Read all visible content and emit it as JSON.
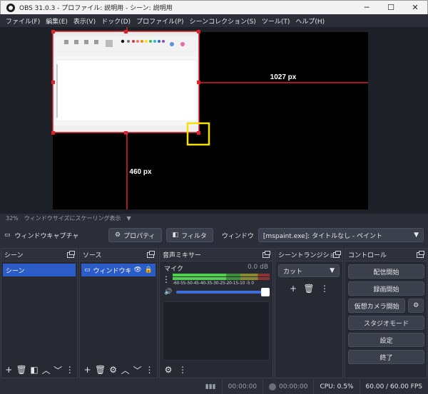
{
  "window": {
    "title": "OBS 31.0.3 - プロファイル: 説明用 - シーン: 説明用",
    "min": "─",
    "max": "☐",
    "close": "✕"
  },
  "menu": [
    "ファイル(F)",
    "編集(E)",
    "表示(V)",
    "ドック(D)",
    "プロファイル(P)",
    "シーンコレクション(S)",
    "ツール(T)",
    "ヘルプ(H)"
  ],
  "preview": {
    "width_label": "1027 px",
    "height_label": "460 px",
    "scale": "32%",
    "scale_mode": "ウィンドウサイズにスケーリング表示"
  },
  "context": {
    "source_name": "ウィンドウキャプチャ",
    "properties": "プロパティ",
    "filters": "フィルタ",
    "window_label": "ウィンドウ",
    "window_value": "[mspaint.exe]: タイトルなし - ペイント"
  },
  "scenes": {
    "title": "シーン",
    "items": [
      "シーン"
    ]
  },
  "sources": {
    "title": "ソース",
    "items": [
      {
        "name": "ウィンドウキャ"
      }
    ]
  },
  "mixer": {
    "title": "音声ミキサー",
    "channel": "マイク",
    "db": "0.0 dB",
    "level": 0.55,
    "volume": 1.0,
    "scale": "-60-55-50-45-40-35-30-25-20-15-10 -5  0"
  },
  "transitions": {
    "title": "シーントランジション",
    "type": "カット"
  },
  "controls": {
    "title": "コントロール",
    "start_stream": "配信開始",
    "start_record": "録画開始",
    "virtual_cam": "仮想カメラ開始",
    "studio_mode": "スタジオモード",
    "settings": "設定",
    "exit": "終了"
  },
  "status": {
    "stream_time": "00:00:00",
    "record_time": "00:00:00",
    "cpu": "CPU: 0.5%",
    "fps": "60.00 / 60.00 FPS"
  }
}
